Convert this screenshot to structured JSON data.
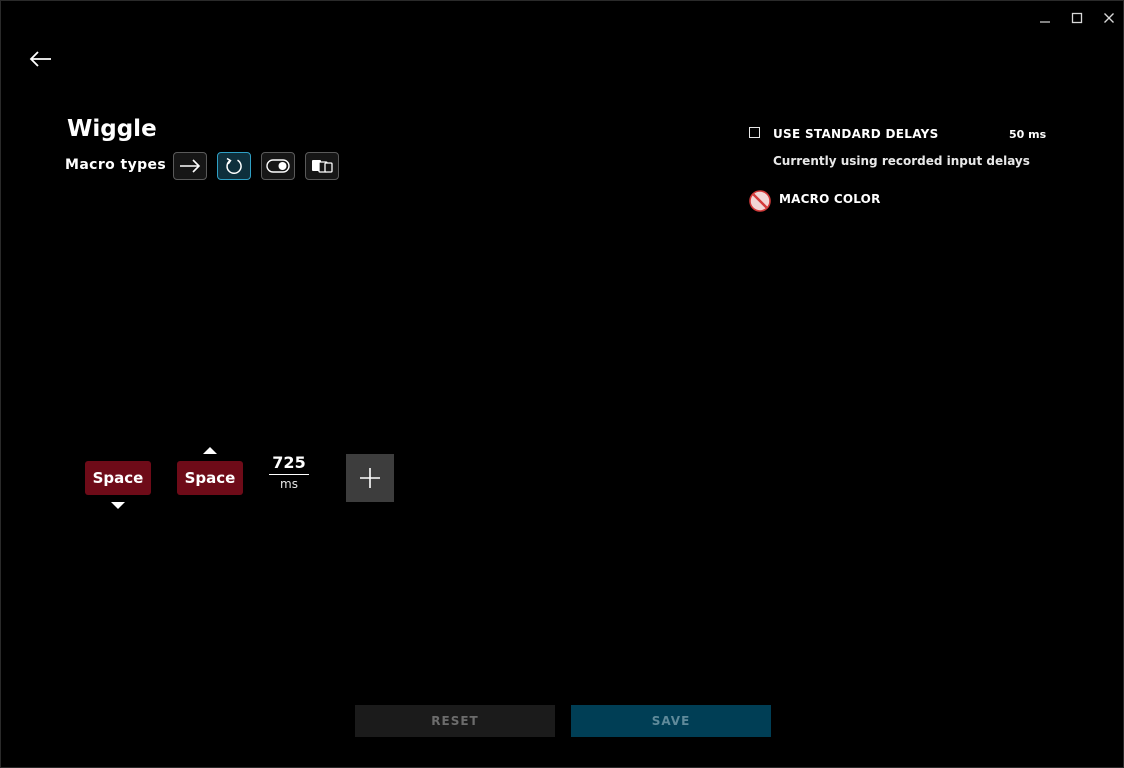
{
  "window_controls": {
    "minimize_icon": "minimize-icon",
    "maximize_icon": "maximize-icon",
    "close_icon": "close-icon"
  },
  "header": {
    "back_icon": "arrow-left-icon",
    "macro_name": "Wiggle",
    "macro_types_label": "Macro types",
    "macro_types": [
      {
        "icon": "arrow-right-icon",
        "selected": false
      },
      {
        "icon": "repeat-icon",
        "selected": true
      },
      {
        "icon": "toggle-icon",
        "selected": false
      },
      {
        "icon": "sequence-icon",
        "selected": false
      }
    ]
  },
  "options": {
    "standard_delays_label": "USE STANDARD DELAYS",
    "standard_delays_checked": false,
    "standard_delays_value": "50 ms",
    "delays_note": "Currently using recorded input delays",
    "macro_color_label": "MACRO COLOR",
    "macro_color_icon": "no-color-icon"
  },
  "timeline": {
    "events": [
      {
        "key": "Space",
        "action": "down",
        "color": "#6e0b18"
      },
      {
        "key": "Space",
        "action": "up",
        "color": "#6e0b18"
      }
    ],
    "delay": {
      "value": "725",
      "unit": "ms"
    },
    "add_icon": "plus-icon"
  },
  "footer": {
    "reset_label": "RESET",
    "save_label": "SAVE"
  },
  "colors": {
    "background": "#000000",
    "key_chip": "#6e0b18",
    "selected_accent": "#2f9fc4",
    "save_button": "#003e55",
    "reset_button": "#1b1b1b"
  }
}
